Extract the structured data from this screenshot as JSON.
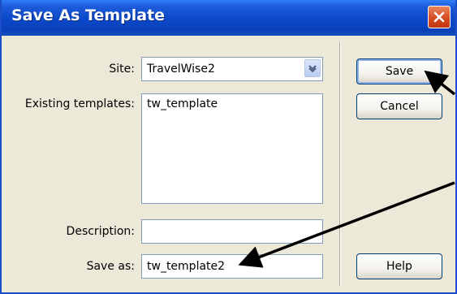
{
  "window": {
    "title": "Save As Template"
  },
  "form": {
    "site_label": "Site:",
    "site_value": "TravelWise2",
    "existing_label": "Existing templates:",
    "existing_items": [
      "tw_template"
    ],
    "description_label": "Description:",
    "description_value": "",
    "save_as_label": "Save as:",
    "save_as_value": "tw_template2"
  },
  "buttons": {
    "save": "Save",
    "cancel": "Cancel",
    "help": "Help"
  },
  "colors": {
    "titlebar": "#0b48c9",
    "dialog_bg": "#ece9d8",
    "close": "#d4481f",
    "annotation_arrow": "#000000"
  },
  "icons": {
    "close": "close-x-icon",
    "dropdown": "chevron-down-icon",
    "annotation": "arrow-icon"
  }
}
